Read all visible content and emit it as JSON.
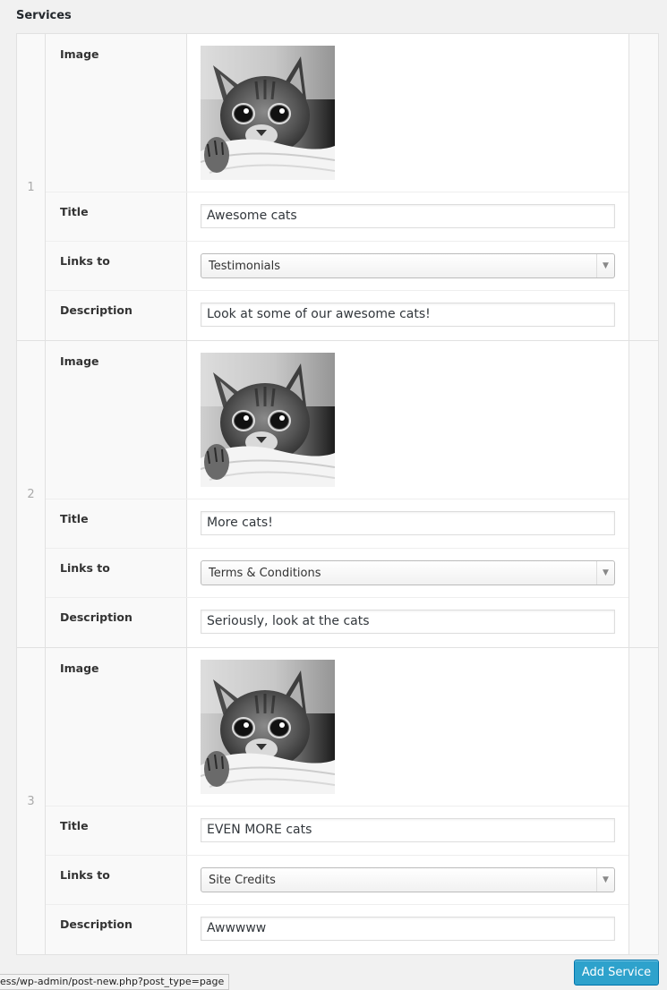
{
  "section": {
    "label": "Services"
  },
  "labels": {
    "image": "Image",
    "title": "Title",
    "links_to": "Links to",
    "description": "Description"
  },
  "rows": [
    {
      "index": "1",
      "title": "Awesome cats",
      "links_to": "Testimonials",
      "description": "Look at some of our awesome cats!"
    },
    {
      "index": "2",
      "title": "More cats!",
      "links_to": "Terms & Conditions",
      "description": "Seriously, look at the cats"
    },
    {
      "index": "3",
      "title": "EVEN MORE cats",
      "links_to": "Site Credits",
      "description": "Awwwww"
    }
  ],
  "add_button": {
    "label": "Add Service"
  },
  "status_bar": {
    "url": "ess/wp-admin/post-new.php?post_type=page"
  },
  "colors": {
    "accent": "#2ea2cc",
    "accent_border": "#0073aa"
  },
  "icons": {
    "select_arrow": "chevron-down-icon"
  }
}
